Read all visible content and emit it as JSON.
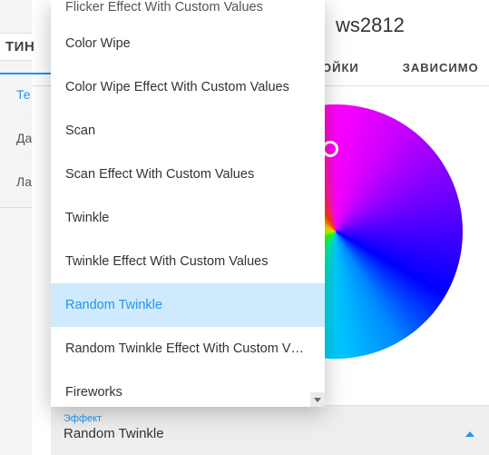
{
  "page": {
    "title": "ws2812"
  },
  "left": {
    "section_title": "ТИН",
    "tabs": [
      "Те",
      "Да",
      "Ла"
    ],
    "active_index": 0
  },
  "top_tabs": {
    "items": [
      "ОЙКИ",
      "ЗАВИСИМО"
    ]
  },
  "effect_field": {
    "label": "Эффект",
    "value": "Random Twinkle"
  },
  "dropdown": {
    "selected_index": 7,
    "items": [
      "Flicker Effect With Custom Values",
      "Color Wipe",
      "Color Wipe Effect With Custom Values",
      "Scan",
      "Scan Effect With Custom Values",
      "Twinkle",
      "Twinkle Effect With Custom Values",
      "Random Twinkle",
      "Random Twinkle Effect With Custom V…",
      "Fireworks"
    ]
  },
  "colors": {
    "accent": "#2196f3"
  }
}
